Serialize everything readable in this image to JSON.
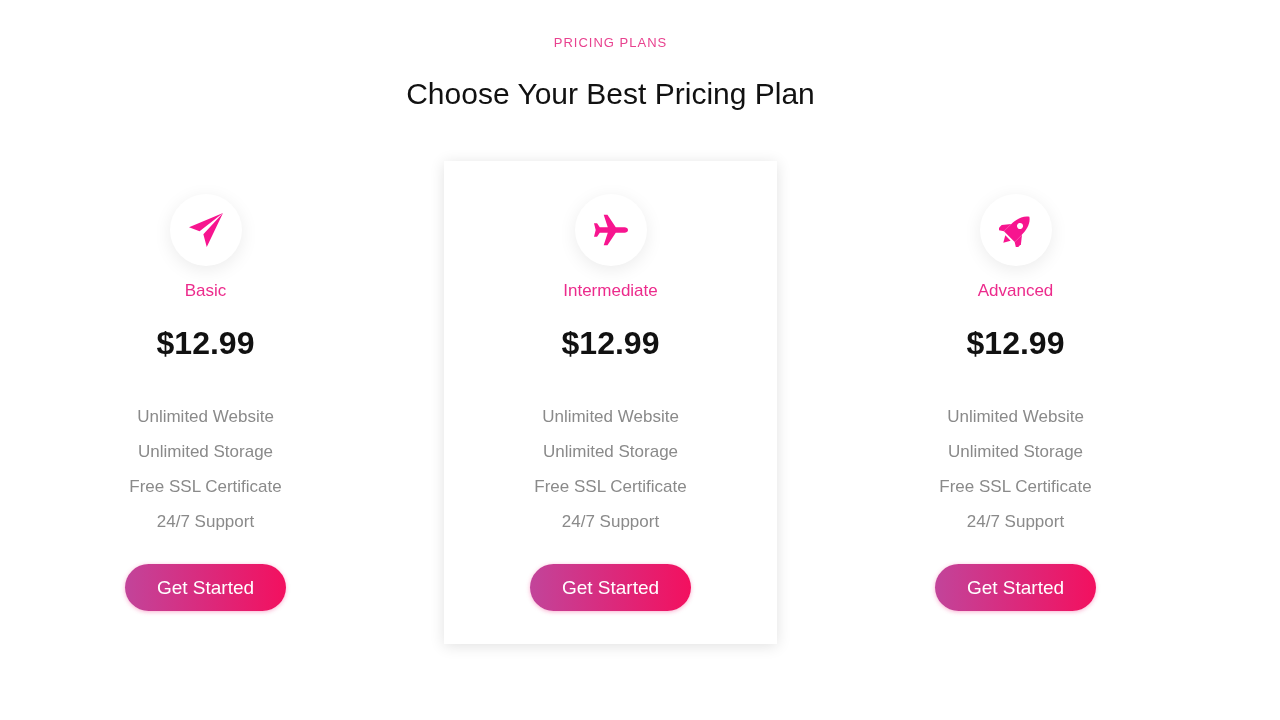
{
  "header": {
    "eyebrow": "PRICING PLANS",
    "title": "Choose Your Best Pricing Plan"
  },
  "plans": [
    {
      "name": "Basic",
      "price": "$12.99",
      "features": [
        "Unlimited Website",
        "Unlimited Storage",
        "Free SSL Certificate",
        "24/7 Support"
      ],
      "button": "Get Started",
      "highlighted": false
    },
    {
      "name": "Intermediate",
      "price": "$12.99",
      "features": [
        "Unlimited Website",
        "Unlimited Storage",
        "Free SSL Certificate",
        "24/7 Support"
      ],
      "button": "Get Started",
      "highlighted": true
    },
    {
      "name": "Advanced",
      "price": "$12.99",
      "features": [
        "Unlimited Website",
        "Unlimited Storage",
        "Free SSL Certificate",
        "24/7 Support"
      ],
      "button": "Get Started",
      "highlighted": false
    }
  ]
}
